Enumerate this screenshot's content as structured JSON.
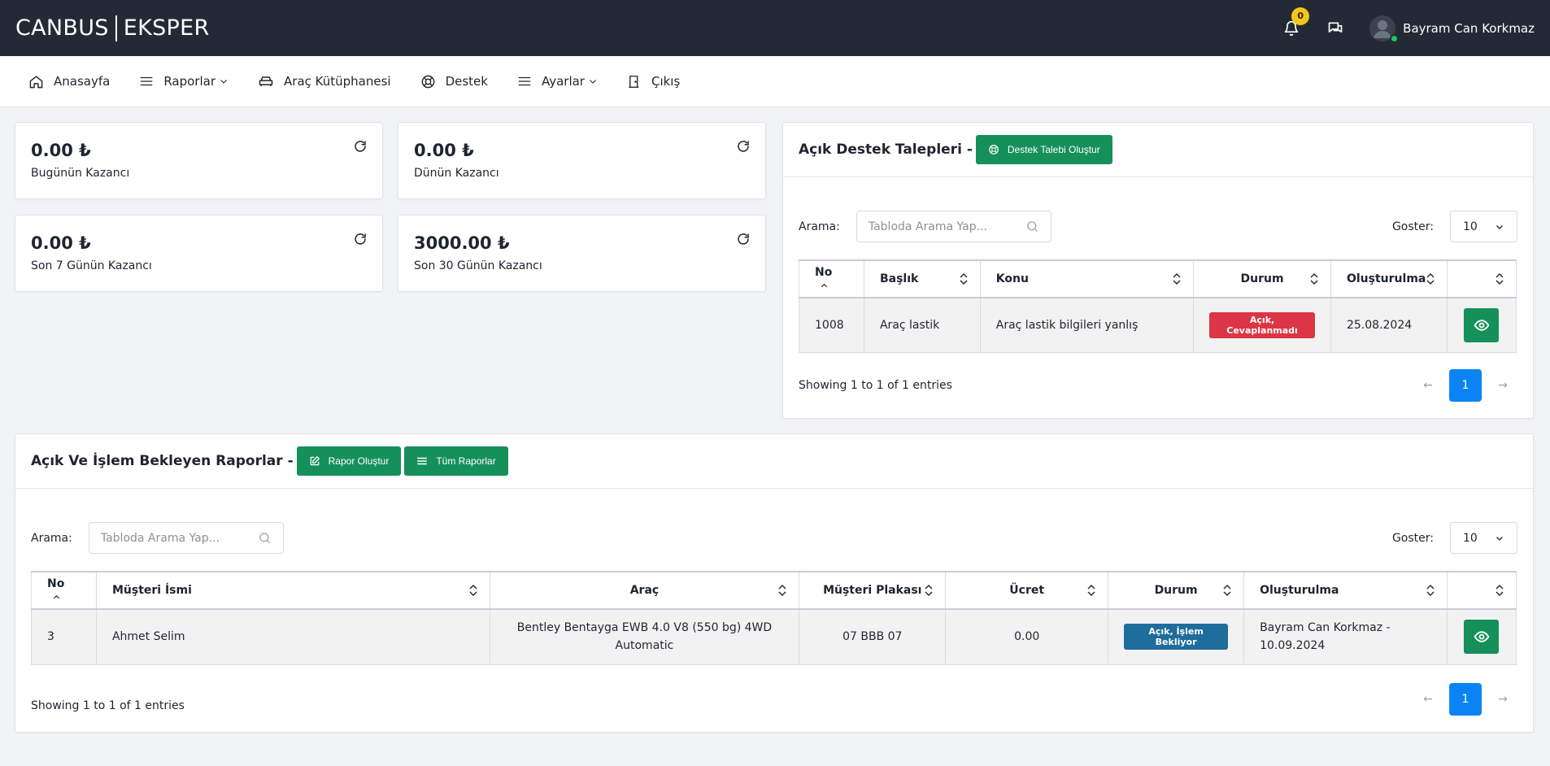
{
  "header": {
    "brand_left": "CANBUS",
    "brand_right": "EKSPER",
    "notification_count": "0",
    "user_name": "Bayram Can Korkmaz"
  },
  "nav": {
    "items": [
      {
        "label": "Anasayfa",
        "icon": "home-icon"
      },
      {
        "label": "Raporlar",
        "icon": "menu-lines-icon",
        "dropdown": true
      },
      {
        "label": "Araç Kütüphanesi",
        "icon": "car-icon"
      },
      {
        "label": "Destek",
        "icon": "lifebuoy-icon"
      },
      {
        "label": "Ayarlar",
        "icon": "menu-lines-icon",
        "dropdown": true
      },
      {
        "label": "Çıkış",
        "icon": "door-icon"
      }
    ]
  },
  "stats": [
    {
      "value": "0.00 ₺",
      "label": "Bugünün Kazancı"
    },
    {
      "value": "0.00 ₺",
      "label": "Dünün Kazancı"
    },
    {
      "value": "0.00 ₺",
      "label": "Son 7 Günün Kazancı"
    },
    {
      "value": "3000.00 ₺",
      "label": "Son 30 Günün Kazancı"
    }
  ],
  "support": {
    "title": "Açık Destek Talepleri -",
    "create_button": "Destek Talebi Oluştur",
    "search_label": "Arama:",
    "search_placeholder": "Tabloda Arama Yap...",
    "show_label": "Goster:",
    "show_value": "10",
    "columns": [
      "No",
      "Başlık",
      "Konu",
      "Durum",
      "Oluşturulma"
    ],
    "rows": [
      {
        "no": "1008",
        "title": "Araç lastik",
        "subject": "Araç lastik bilgileri yanlış",
        "status": "Açık, Cevaplanmadı",
        "created": "25.08.2024"
      }
    ],
    "showing": "Showing 1 to 1 of 1 entries",
    "page": "1"
  },
  "reports": {
    "title": "Açık Ve İşlem Bekleyen Raporlar -",
    "create_button": "Rapor Oluştur",
    "all_button": "Tüm Raporlar",
    "search_label": "Arama:",
    "search_placeholder": "Tabloda Arama Yap...",
    "show_label": "Goster:",
    "show_value": "10",
    "columns": [
      "No",
      "Müşteri İsmi",
      "Araç",
      "Müşteri Plakası",
      "Ücret",
      "Durum",
      "Oluşturulma"
    ],
    "rows": [
      {
        "no": "3",
        "customer": "Ahmet Selim",
        "vehicle_line1": "Bentley Bentayga EWB 4.0 V8 (550 bg) 4WD",
        "vehicle_line2": "Automatic",
        "plate": "07 BBB 07",
        "fee": "0.00",
        "status": "Açık, İşlem Bekliyor",
        "created_line1": "Bayram Can Korkmaz -",
        "created_line2": "10.09.2024"
      }
    ],
    "showing": "Showing 1 to 1 of 1 entries",
    "page": "1"
  },
  "colors": {
    "topbar": "#232a36",
    "primary_green": "#16905a",
    "status_red": "#dc3545",
    "status_blue": "#1f6d9c",
    "page_blue": "#0b84f3",
    "badge_yellow": "#f5c518"
  }
}
